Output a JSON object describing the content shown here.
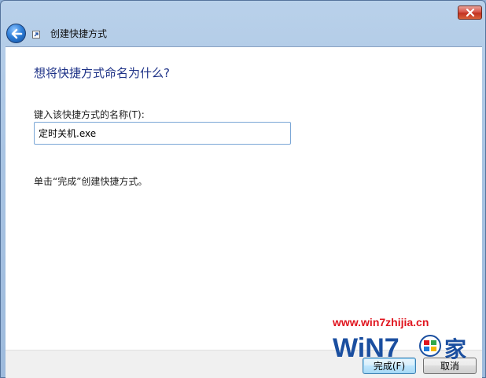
{
  "window": {
    "title": "创建快捷方式"
  },
  "page": {
    "heading": "想将快捷方式命名为什么?",
    "field_label": "键入该快捷方式的名称(T):",
    "name_value": "定时关机.exe",
    "hint": "单击“完成”创建快捷方式。"
  },
  "buttons": {
    "finish": "完成(F)",
    "cancel": "取消"
  },
  "watermark": {
    "url": "www.win7zhijia.cn",
    "logo_text": "WiN7",
    "logo_suffix": "家"
  },
  "colors": {
    "heading": "#1e3287",
    "watermark_red": "#e0141e",
    "watermark_blue": "#1b4fa0"
  }
}
